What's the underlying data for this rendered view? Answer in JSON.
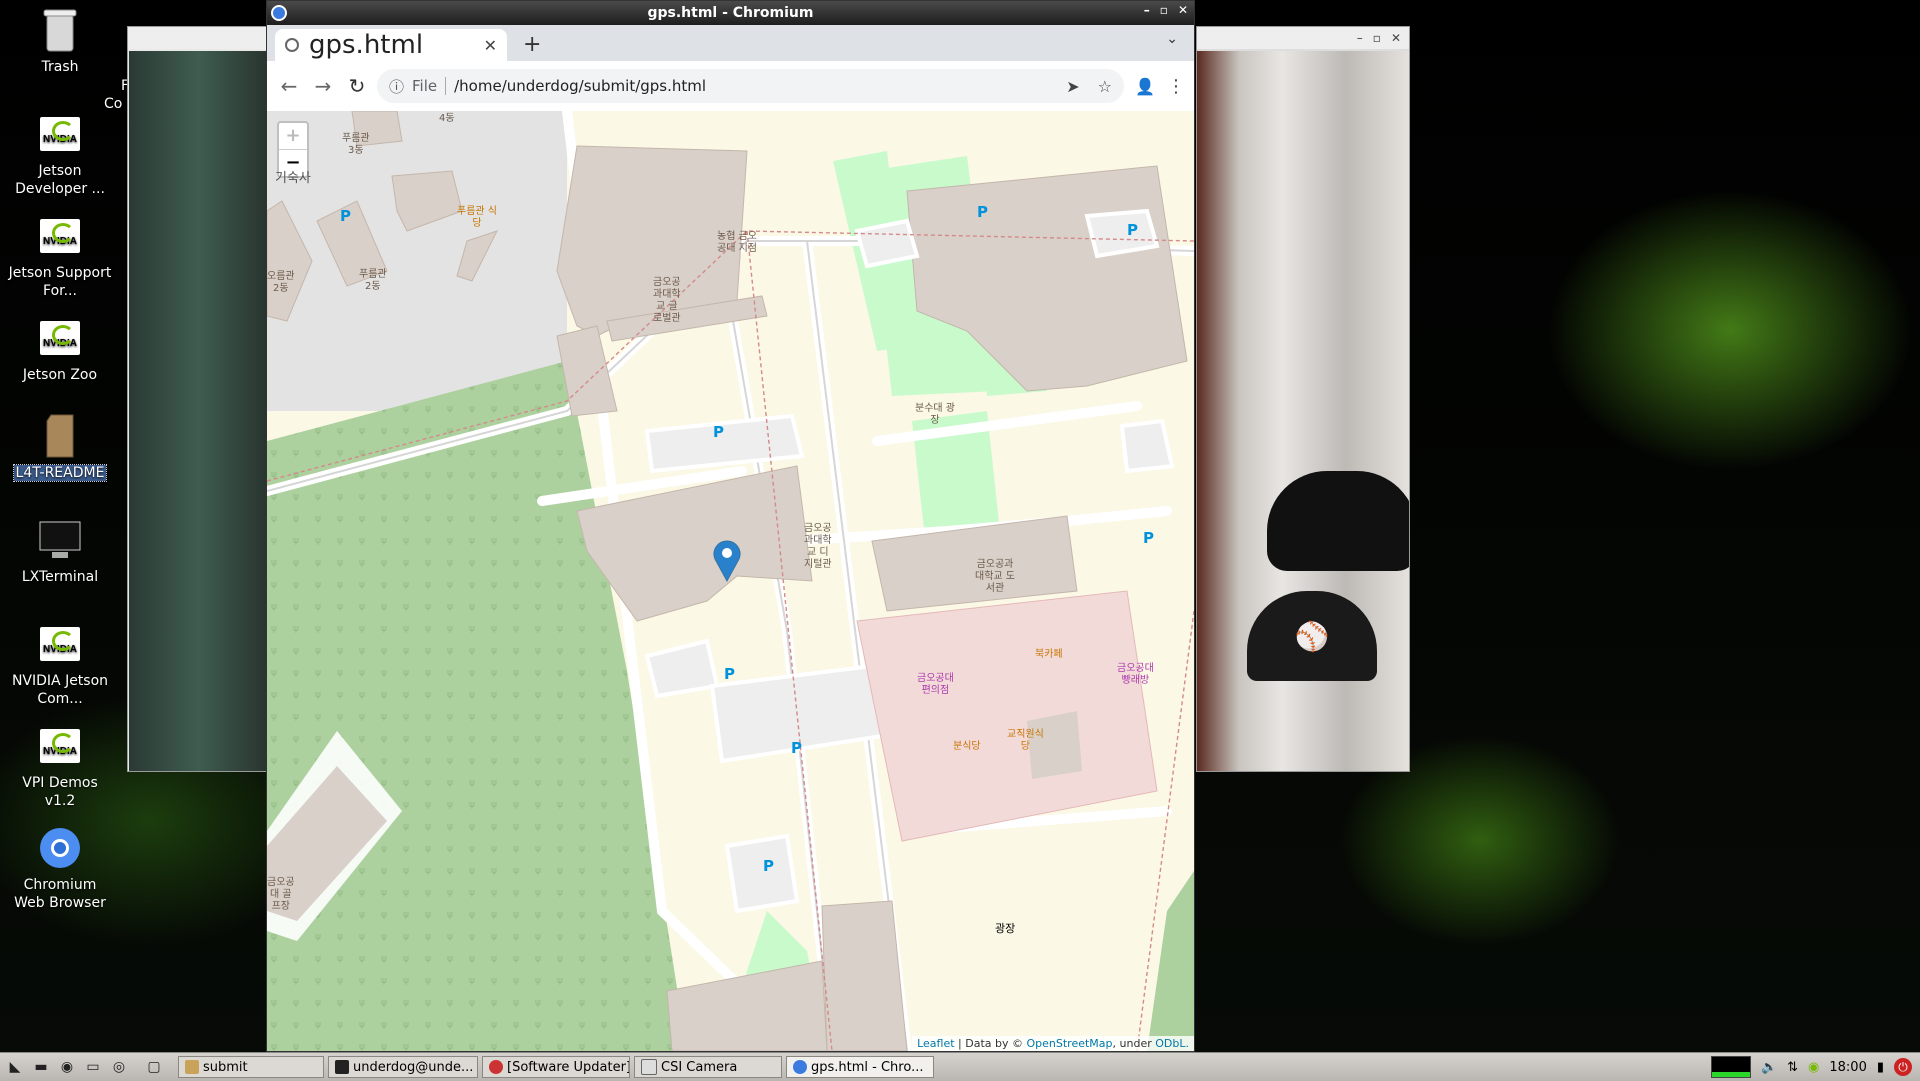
{
  "desktop": {
    "icons": [
      {
        "label": "Trash",
        "name": "trash"
      },
      {
        "label": "Jetson Developer ...",
        "name": "jetson-developer"
      },
      {
        "label": "Jetson Support For...",
        "name": "jetson-support"
      },
      {
        "label": "Jetson Zoo",
        "name": "jetson-zoo"
      },
      {
        "label": "L4T-README",
        "name": "l4t-readme"
      },
      {
        "label": "LXTerminal",
        "name": "lxterminal"
      },
      {
        "label": "NVIDIA Jetson Com...",
        "name": "nvidia-jetson-com"
      },
      {
        "label": "VPI Demos v1.2",
        "name": "vpi-demos"
      },
      {
        "label": "Chromium Web Browser",
        "name": "chromium"
      }
    ],
    "nvidia_text": "NVIDIA",
    "partial_text_1": "F",
    "partial_text_2": "Co"
  },
  "window": {
    "title": "gps.html - Chromium",
    "controls": [
      "–",
      "▫",
      "✕"
    ]
  },
  "tabs": [
    {
      "label": "gps.html",
      "close": "✕"
    }
  ],
  "toolbar": {
    "new_tab": "+",
    "tab_menu": "⌄",
    "back": "←",
    "forward": "→",
    "reload": "↻",
    "site_info": "ⓘ",
    "scheme_label": "File",
    "url": "/home/underdog/submit/gps.html",
    "send": "➤",
    "bookmark": "☆",
    "profile": "👤",
    "menu": "⋮"
  },
  "map": {
    "zoom_in": "+",
    "zoom_out": "−",
    "labels": {
      "dorm": "기숙사",
      "dorm3": "푸름관\n3동",
      "dorm2": "푸름관\n2동",
      "dorm2b": "오름관\n2동",
      "floor4": "4동",
      "cafeteria": "푸름관 식\n당",
      "nh_bank": "농협 금오\n공대 지점",
      "global_hall": "금오공\n과대학\n교 글\n로벌관",
      "fountain": "분수대 광\n장",
      "digital_hall": "금오공\n과대학\n교 디\n지털관",
      "library": "금오공과\n대학교 도\n서관",
      "book_cafe": "북카페",
      "store": "금오공대\n편의점",
      "bakery": "금오공대\n빵래방",
      "snack": "분식당",
      "staff_rest": "교직원식\n당",
      "plaza": "광장",
      "golf": "금오공\n대 골\n프장"
    },
    "parking": "P",
    "attribution": {
      "leaflet": "Leaflet",
      "data_by": " | Data by © ",
      "osm": "OpenStreetMap",
      "under": ", under ",
      "odbl": "ODbL."
    }
  },
  "taskbar": {
    "tasks": [
      {
        "label": "submit"
      },
      {
        "label": "underdog@unde..."
      },
      {
        "label": "[Software Updater]"
      },
      {
        "label": "CSI Camera"
      },
      {
        "label": "gps.html - Chro..."
      }
    ],
    "clock": "18:00"
  },
  "colors": {
    "accent": "#76b900",
    "park_green": "#add19e",
    "building": "#d9d0c9",
    "campus": "#fbf8e6",
    "marker": "#2a81cb"
  }
}
